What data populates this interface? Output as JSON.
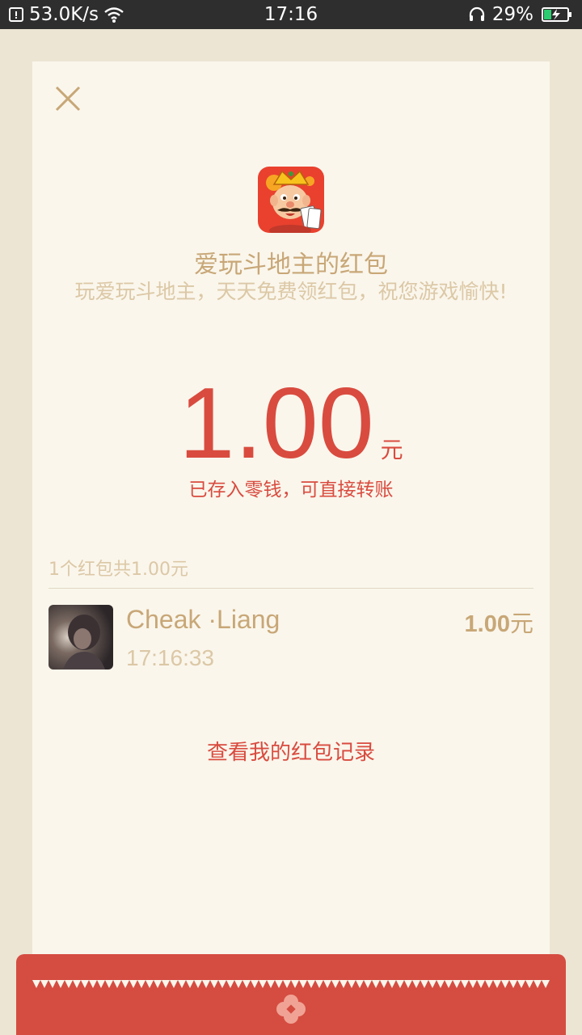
{
  "status_bar": {
    "net_speed": "53.0K/s",
    "time": "17:16",
    "battery_percent": "29%",
    "icons": [
      "data-saver-icon",
      "wifi-icon",
      "headset-icon",
      "battery-charging-icon"
    ]
  },
  "envelope": {
    "close_icon": "close-icon",
    "app_icon": "doudizhu-app-icon",
    "sender_title": "爱玩斗地主的红包",
    "greeting": "玩爱玩斗地主，天天免费领红包，祝您游戏愉快!",
    "amount": "1.00",
    "amount_unit": "元",
    "saved_note": "已存入零钱，可直接转账",
    "summary": "1个红包共1.00元",
    "records": [
      {
        "name": "Cheak ·Liang",
        "time": "17:16:33",
        "amount": "1.00",
        "amount_unit": "元"
      }
    ],
    "view_records_link": "查看我的红包记录"
  },
  "colors": {
    "page_bg": "#ece5d4",
    "card_bg": "#faf6ec",
    "accent_red": "#d94b3f",
    "gold_text": "#c8a777",
    "muted_text": "#dcc8a6",
    "envelope_red": "#d54c41"
  }
}
